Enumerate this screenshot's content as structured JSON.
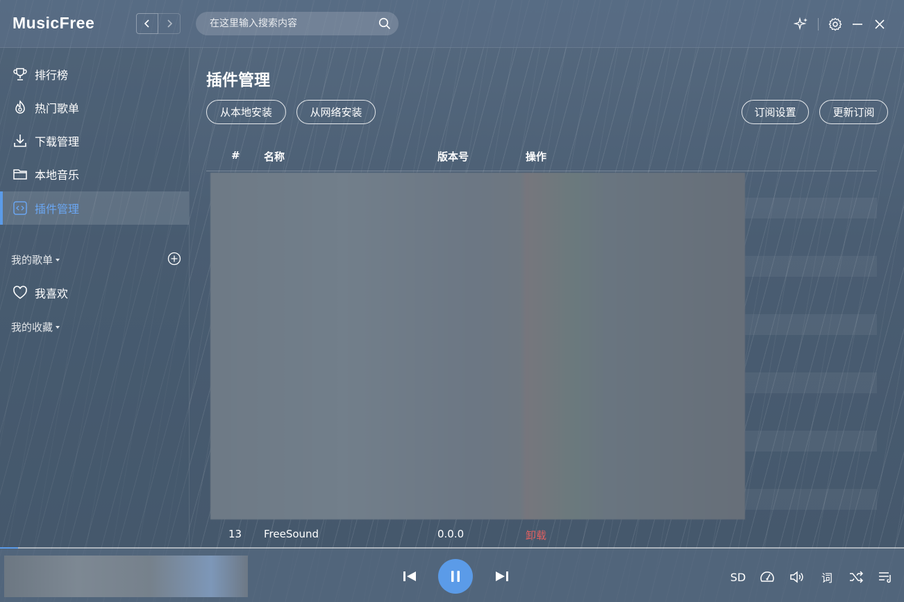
{
  "app": {
    "title": "MusicFree"
  },
  "search": {
    "placeholder": "在这里输入搜索内容"
  },
  "sidebar": {
    "items": [
      {
        "label": "排行榜",
        "icon": "trophy-icon"
      },
      {
        "label": "热门歌单",
        "icon": "flame-icon"
      },
      {
        "label": "下载管理",
        "icon": "download-icon"
      },
      {
        "label": "本地音乐",
        "icon": "folder-icon"
      },
      {
        "label": "插件管理",
        "icon": "code-icon",
        "active": true
      }
    ],
    "my_playlists": {
      "label": "我的歌单"
    },
    "favorites": {
      "label": "我喜欢",
      "icon": "heart-icon"
    },
    "my_collections": {
      "label": "我的收藏"
    }
  },
  "main": {
    "title": "插件管理",
    "buttons": {
      "install_local": "从本地安装",
      "install_network": "从网络安装",
      "subscription_settings": "订阅设置",
      "update_subscription": "更新订阅"
    },
    "table": {
      "headers": [
        "#",
        "名称",
        "版本号",
        "操作"
      ],
      "rows": [
        {
          "index": "13",
          "name": "FreeSound",
          "version": "0.0.0",
          "action": "卸载"
        }
      ]
    }
  },
  "player": {
    "quality": "SD",
    "lyrics": "词",
    "progress_fraction": 0.02
  },
  "colors": {
    "accent": "#5b9be8",
    "danger": "#e06060"
  }
}
